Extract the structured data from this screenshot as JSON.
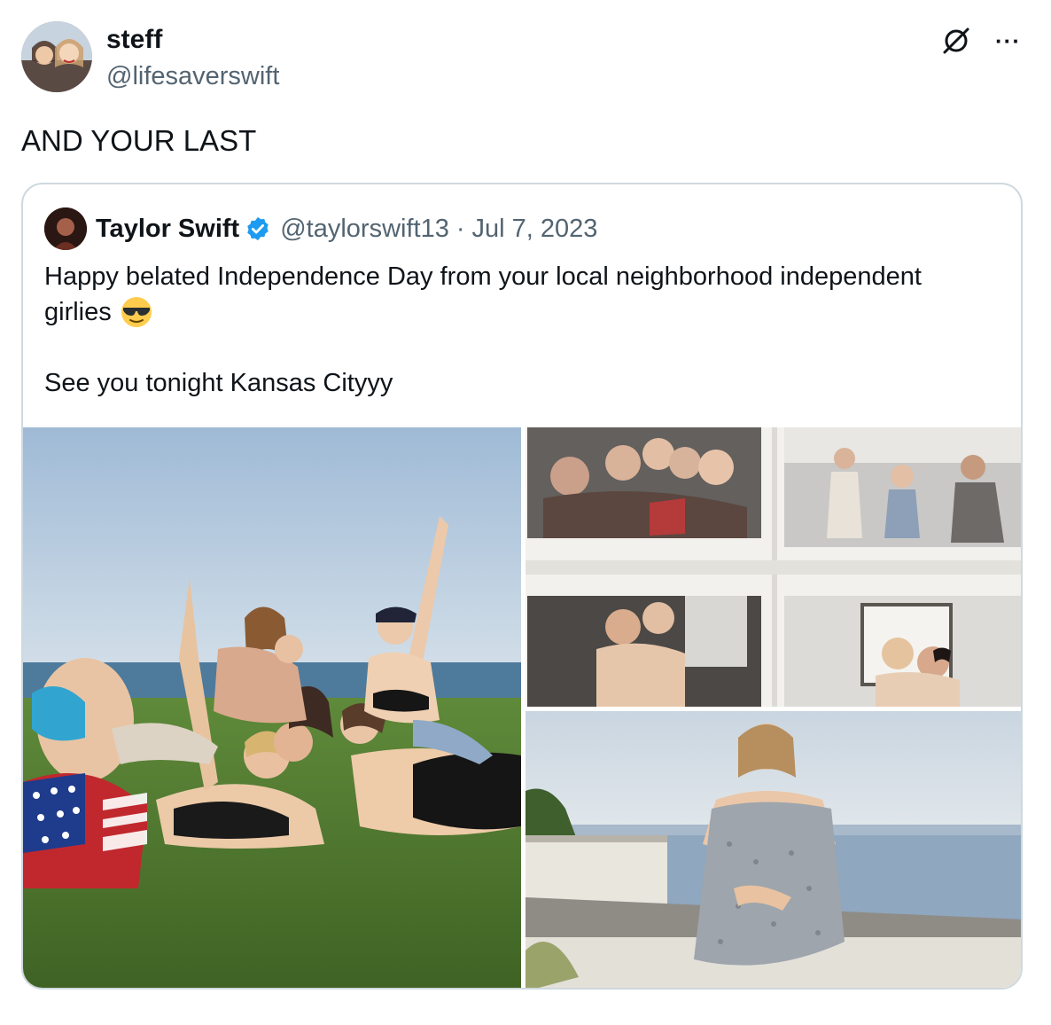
{
  "tweet": {
    "author_name": "steff",
    "author_handle": "@lifesaverswift",
    "text": "AND YOUR LAST",
    "more_label": "···"
  },
  "quote": {
    "author_name": "Taylor Swift",
    "author_handle": "@taylorswift13",
    "separator": "·",
    "date": "Jul 7, 2023",
    "text_line1": "Happy belated Independence Day from your local neighborhood independent",
    "text_line2": "girlies",
    "text_line3": "See you tonight Kansas Cityyy",
    "emoji": "smiling-face-with-sunglasses",
    "verified_color": "#1d9bf0"
  },
  "icons": {
    "grok": "grok-icon",
    "more": "more-icon",
    "verified": "verified-badge-icon"
  },
  "colors": {
    "text_primary": "#0f1419",
    "text_secondary": "#536471",
    "border": "#cfd9de"
  }
}
